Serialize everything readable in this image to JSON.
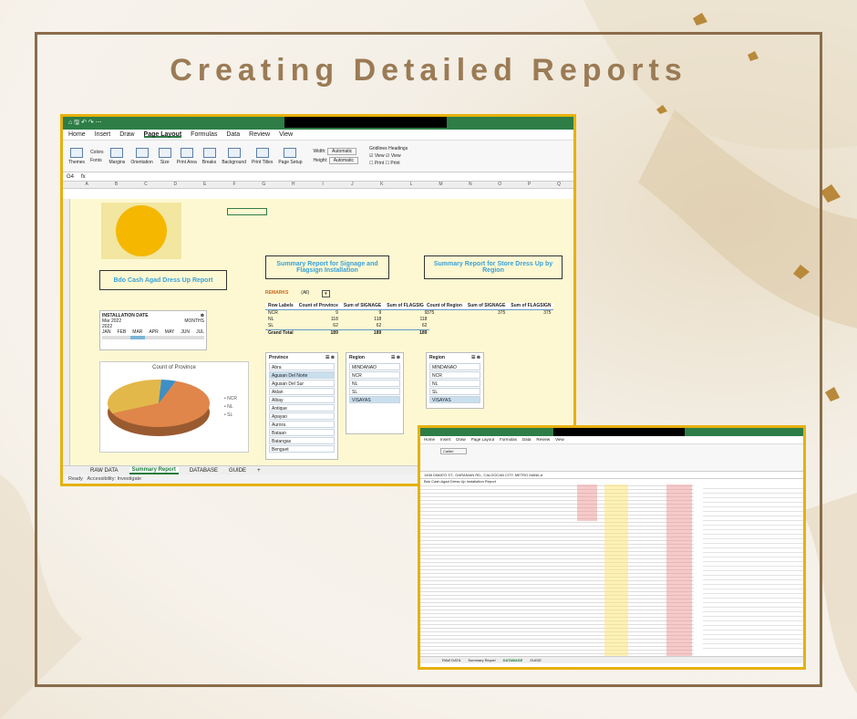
{
  "headline": "Creating Detailed Reports",
  "workbook": {
    "menus": [
      "Home",
      "Insert",
      "Draw",
      "Page Layout",
      "Formulas",
      "Data",
      "Review",
      "View"
    ],
    "active_menu": "Page Layout",
    "ribbon": {
      "themes": "Themes",
      "colors": "Colors",
      "fonts": "Fonts",
      "margins": "Margins",
      "orientation": "Orientation",
      "size": "Size",
      "print_area": "Print Area",
      "breaks": "Breaks",
      "background": "Background",
      "print_titles": "Print Titles",
      "page_setup": "Page Setup",
      "width_label": "Width:",
      "width_value": "Automatic",
      "height_label": "Height:",
      "height_value": "Automatic",
      "gridlines": "Gridlines",
      "headings": "Headings",
      "view": "View",
      "print": "Print"
    },
    "name_box": "G4",
    "fx": "fx",
    "columns": [
      "A",
      "B",
      "C",
      "D",
      "E",
      "F",
      "G",
      "H",
      "I",
      "J",
      "K",
      "L",
      "M",
      "N",
      "O",
      "P",
      "Q"
    ],
    "report_title": "Bdo Cash Agad Dress Up Report",
    "signage_title": "Summary Report for Signage and Flagsign Installation",
    "store_title": "Summary Report for Store Dress Up by Region",
    "remarks_label": "REMARKS",
    "remarks_value": "(All)",
    "pivot1": {
      "headers": [
        "Row Labels",
        "Count of Province",
        "Sum of SIGNAGE",
        "Sum of FLAGSIGN"
      ],
      "rows": [
        [
          "NCR",
          "9",
          "9",
          "9"
        ],
        [
          "NL",
          "118",
          "118",
          "118"
        ],
        [
          "SL",
          "62",
          "62",
          "62"
        ],
        [
          "Grand Total",
          "189",
          "189",
          "189"
        ]
      ]
    },
    "pivot2": {
      "headers": [
        "Count of Region",
        "Sum of SIGNAGE",
        "Sum of FLAGSIGN"
      ],
      "rows": [
        [
          "375",
          "375",
          "375"
        ]
      ]
    },
    "timeline": {
      "title": "INSTALLATION DATE",
      "period": "Mar 2022",
      "unit": "MONTHS",
      "year": "2022",
      "months": [
        "JAN",
        "FEB",
        "MAR",
        "APR",
        "MAY",
        "JUN",
        "JUL"
      ]
    },
    "province_slicer": {
      "title": "Province",
      "items": [
        "Abra",
        "Agusan Del Norte",
        "Agusan Del Sur",
        "Aklan",
        "Albay",
        "Antique",
        "Apayao",
        "Aurora",
        "Bataan",
        "Batangas",
        "Benguet"
      ],
      "selected": "Agusan Del Norte"
    },
    "region_slicer1": {
      "title": "Region",
      "items": [
        "MINDANAO",
        "NCR",
        "NL",
        "SL",
        "VISAYAS"
      ],
      "selected": "VISAYAS"
    },
    "region_slicer2": {
      "title": "Region",
      "items": [
        "MINDANAO",
        "NCR",
        "NL",
        "SL",
        "VISAYAS"
      ],
      "selected": "VISAYAS"
    },
    "chart_title": "Count of Province",
    "chart_data": {
      "type": "pie",
      "title": "Count of Province",
      "categories": [
        "NCR",
        "NL",
        "SL"
      ],
      "values": [
        9,
        118,
        62
      ]
    },
    "legend": [
      "NCR",
      "NL",
      "SL"
    ],
    "colors": {
      "ncr": "#3d8fc5",
      "nl": "#e0864a",
      "sl": "#e3b84a",
      "excel_green": "#2e7d46",
      "frame_gold": "#e6b10c"
    },
    "sheet_tabs": [
      "RAW DATA",
      "Summary Report",
      "DATABASE",
      "GUIDE"
    ],
    "active_tab": "Summary Report",
    "status": "Ready",
    "accessibility": "Accessibility: Investigate"
  },
  "workbook2": {
    "menus": [
      "Home",
      "Insert",
      "Draw",
      "Page Layout",
      "Formulas",
      "Data",
      "Review",
      "View"
    ],
    "font": "Calibri",
    "formula": "1458 DIMATO ST., GARANIAN RD., CALOOCAN CITY, METRO MANILA",
    "title_cell": "Bdo Cash Agad Dress Up Installation Report",
    "sheet_tabs": [
      "RAW DATA",
      "Summary Report",
      "DATABASE",
      "GUIDE"
    ],
    "active_tab": "DATABASE"
  }
}
